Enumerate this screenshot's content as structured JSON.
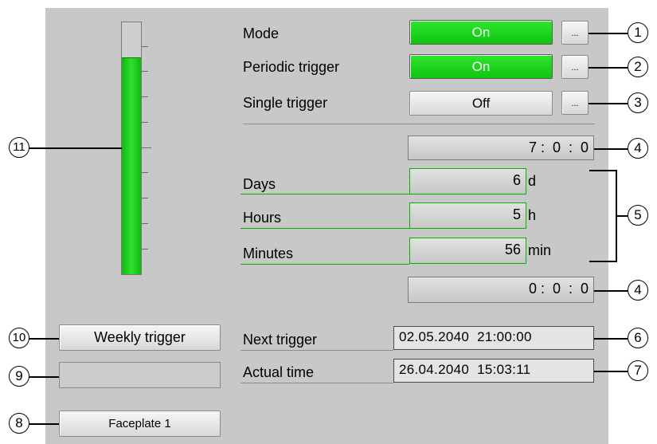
{
  "colors": {
    "panel": "#c8c8c8",
    "on_green": "#22d422",
    "bar_green": "#18c818"
  },
  "bar": {
    "level_fraction": 0.86,
    "icon": "vertical-bar-graph"
  },
  "rows": {
    "mode": {
      "label": "Mode",
      "state": "On",
      "dots": "..."
    },
    "periodic": {
      "label": "Periodic trigger",
      "state": "On",
      "dots": "..."
    },
    "single": {
      "label": "Single trigger",
      "state": "Off",
      "dots": "..."
    }
  },
  "period_time": "7 :  0  :  0",
  "interval": {
    "days": {
      "label": "Days",
      "value": "6",
      "unit": "d"
    },
    "hours": {
      "label": "Hours",
      "value": "5",
      "unit": "h"
    },
    "minutes": {
      "label": "Minutes",
      "value": "56",
      "unit": "min"
    }
  },
  "offset_time": "0 :  0  :  0",
  "buttons": {
    "weekly": "Weekly trigger",
    "faceplate": "Faceplate 1"
  },
  "next_trigger": {
    "label": "Next trigger",
    "value": "02.05.2040  21:00:00"
  },
  "actual_time": {
    "label": "Actual time",
    "value": "26.04.2040  15:03:11"
  },
  "callouts": [
    "1",
    "2",
    "3",
    "4",
    "5",
    "4",
    "6",
    "7",
    "8",
    "9",
    "10",
    "11"
  ]
}
